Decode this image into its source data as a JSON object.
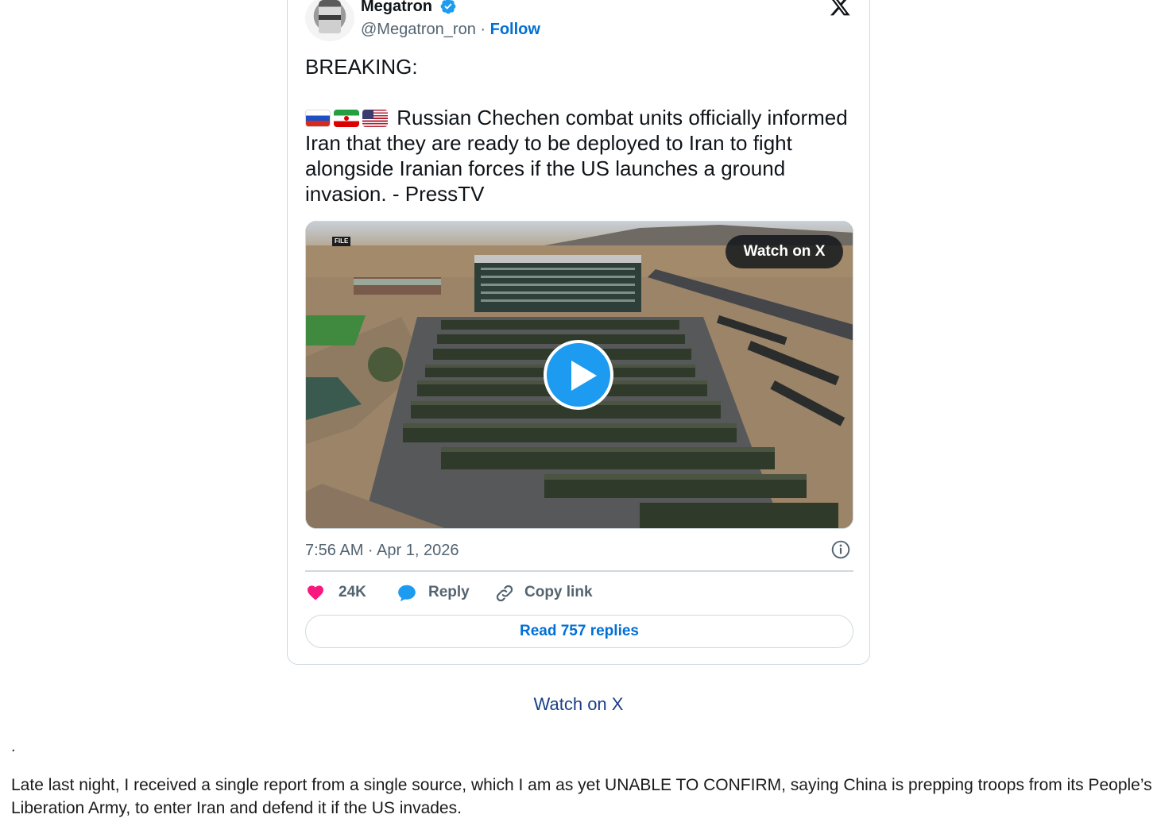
{
  "tweet": {
    "author_name": "Megatron",
    "handle": "@Megatron_ron",
    "separator": " · ",
    "follow_label": "Follow",
    "lead": "BREAKING:",
    "flags": [
      "flag-ru-icon",
      "flag-ir-icon",
      "flag-us-icon"
    ],
    "body": "Russian Chechen combat units officially informed Iran that they are ready to be deployed to Iran to fight alongside Iranian forces if the US launches a ground invasion. - PressTV",
    "media": {
      "watch_badge": "Watch on X",
      "file_tag": "FILE"
    },
    "timestamp": "7:56 AM · Apr 1, 2026",
    "actions": {
      "likes_count": "24K",
      "reply_label": "Reply",
      "copy_link_label": "Copy link"
    },
    "read_replies_label": "Read 757 replies"
  },
  "article": {
    "watch_link": "Watch on X",
    "dot": ".",
    "paragraph": "Late last night, I received a single report from a single source, which I am as yet UNABLE TO CONFIRM, saying China is prepping troops from its People’s Liberation Army, to enter Iran and defend it if the US invades."
  },
  "colors": {
    "link_blue": "#006fd6",
    "play_blue": "#1d9bf0",
    "like_pink": "#f91880",
    "muted_text": "#536471",
    "border": "#cfd9de",
    "article_link": "#1a3f86"
  }
}
